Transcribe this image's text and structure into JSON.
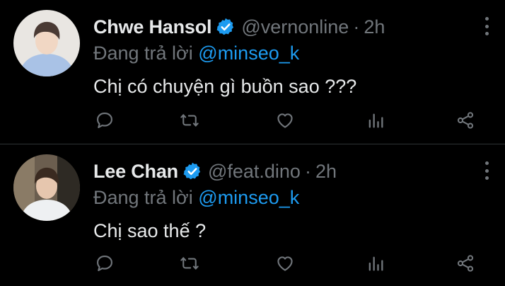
{
  "colors": {
    "background": "#000000",
    "text": "#e7e9ea",
    "muted": "#71767b",
    "accent": "#1d9bf0",
    "divider": "#2f3336"
  },
  "tweets": [
    {
      "author_name": "Chwe Hansol",
      "handle": "@vernonline",
      "separator": "·",
      "time": "2h",
      "reply_prefix": "Đang trả lời",
      "reply_to": "@minseo_k",
      "text": "Chị có chuyện gì buồn sao ???",
      "verified": true,
      "actions": [
        "reply-icon",
        "retweet-icon",
        "like-icon",
        "analytics-icon",
        "share-icon"
      ]
    },
    {
      "author_name": "Lee Chan",
      "handle": "@feat.dino",
      "separator": "·",
      "time": "2h",
      "reply_prefix": "Đang trả lời",
      "reply_to": "@minseo_k",
      "text": "Chị sao thế ?",
      "verified": true,
      "actions": [
        "reply-icon",
        "retweet-icon",
        "like-icon",
        "analytics-icon",
        "share-icon"
      ]
    }
  ]
}
